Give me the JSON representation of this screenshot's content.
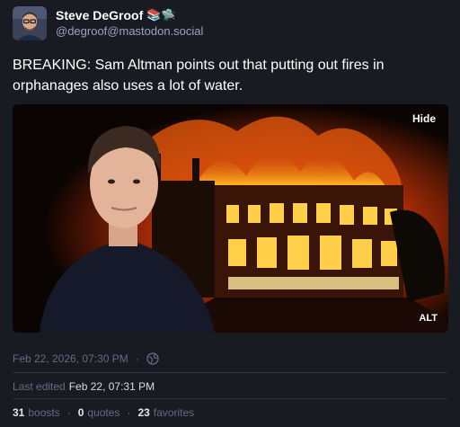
{
  "author": {
    "display_name": "Steve DeGroof",
    "emoji": "📚🛸",
    "handle": "@degroof@mastodon.social"
  },
  "post": {
    "text": "BREAKING: Sam Altman points out that putting out fires in orphanages also uses a lot of water."
  },
  "media": {
    "hide_label": "Hide",
    "alt_label": "ALT"
  },
  "meta": {
    "timestamp": "Feb 22, 2026, 07:30 PM",
    "separator": "·",
    "visibility_icon": "globe-icon",
    "edited_label": "Last edited",
    "edited_time": "Feb 22, 07:31 PM"
  },
  "stats": {
    "boosts_count": "31",
    "boosts_label": "boosts",
    "quotes_count": "0",
    "quotes_label": "quotes",
    "favorites_count": "23",
    "favorites_label": "favorites",
    "separator": "·"
  },
  "colors": {
    "background": "#191b22",
    "muted_text": "#636b85",
    "handle_text": "#9ba3c4"
  }
}
